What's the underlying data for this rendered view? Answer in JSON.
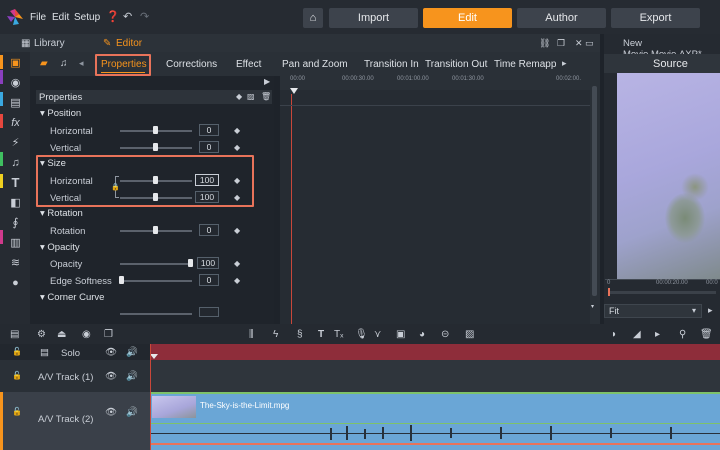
{
  "menu": {
    "file": "File",
    "edit": "Edit",
    "setup": "Setup"
  },
  "nav": {
    "import": "Import",
    "edit": "Edit",
    "author": "Author",
    "export": "Export"
  },
  "panels": {
    "library": "Library",
    "editor": "Editor",
    "project_title": "New Movie.Movie.AXP*"
  },
  "tabs": [
    "Properties",
    "Corrections",
    "Effect",
    "Pan and Zoom",
    "Transition In",
    "Transition Out",
    "Time Remappin"
  ],
  "properties": {
    "header": "Properties",
    "position": {
      "title": "Position",
      "horizontal": "Horizontal",
      "vertical": "Vertical",
      "h_val": "0",
      "v_val": "0"
    },
    "size": {
      "title": "Size",
      "horizontal": "Horizontal",
      "vertical": "Vertical",
      "h_val": "100",
      "v_val": "100"
    },
    "rotation": {
      "title": "Rotation",
      "label": "Rotation",
      "val": "0"
    },
    "opacity": {
      "title": "Opacity",
      "label": "Opacity",
      "val": "100",
      "edge": "Edge Softness",
      "edge_val": "0"
    },
    "corner": {
      "title": "Corner Curve"
    }
  },
  "ruler": [
    "00:00",
    "00:00:30.00",
    "00:01:00.00",
    "00:01:30.00",
    "00:02:00."
  ],
  "source": {
    "title": "Source",
    "time_start": "0",
    "time_mid": "00:00:20.00",
    "time_end": "00:0",
    "fit": "Fit"
  },
  "tracks": {
    "solo": "Solo",
    "av1": "A/V Track (1)",
    "av2": "A/V Track (2)",
    "clip": "The-Sky-is-the-Limit.mpg"
  },
  "colors": {
    "accent": "#f7941d",
    "highlight": "#e8735a",
    "track_red": "#8e2d3a",
    "clip_blue": "#6aa6d6"
  }
}
